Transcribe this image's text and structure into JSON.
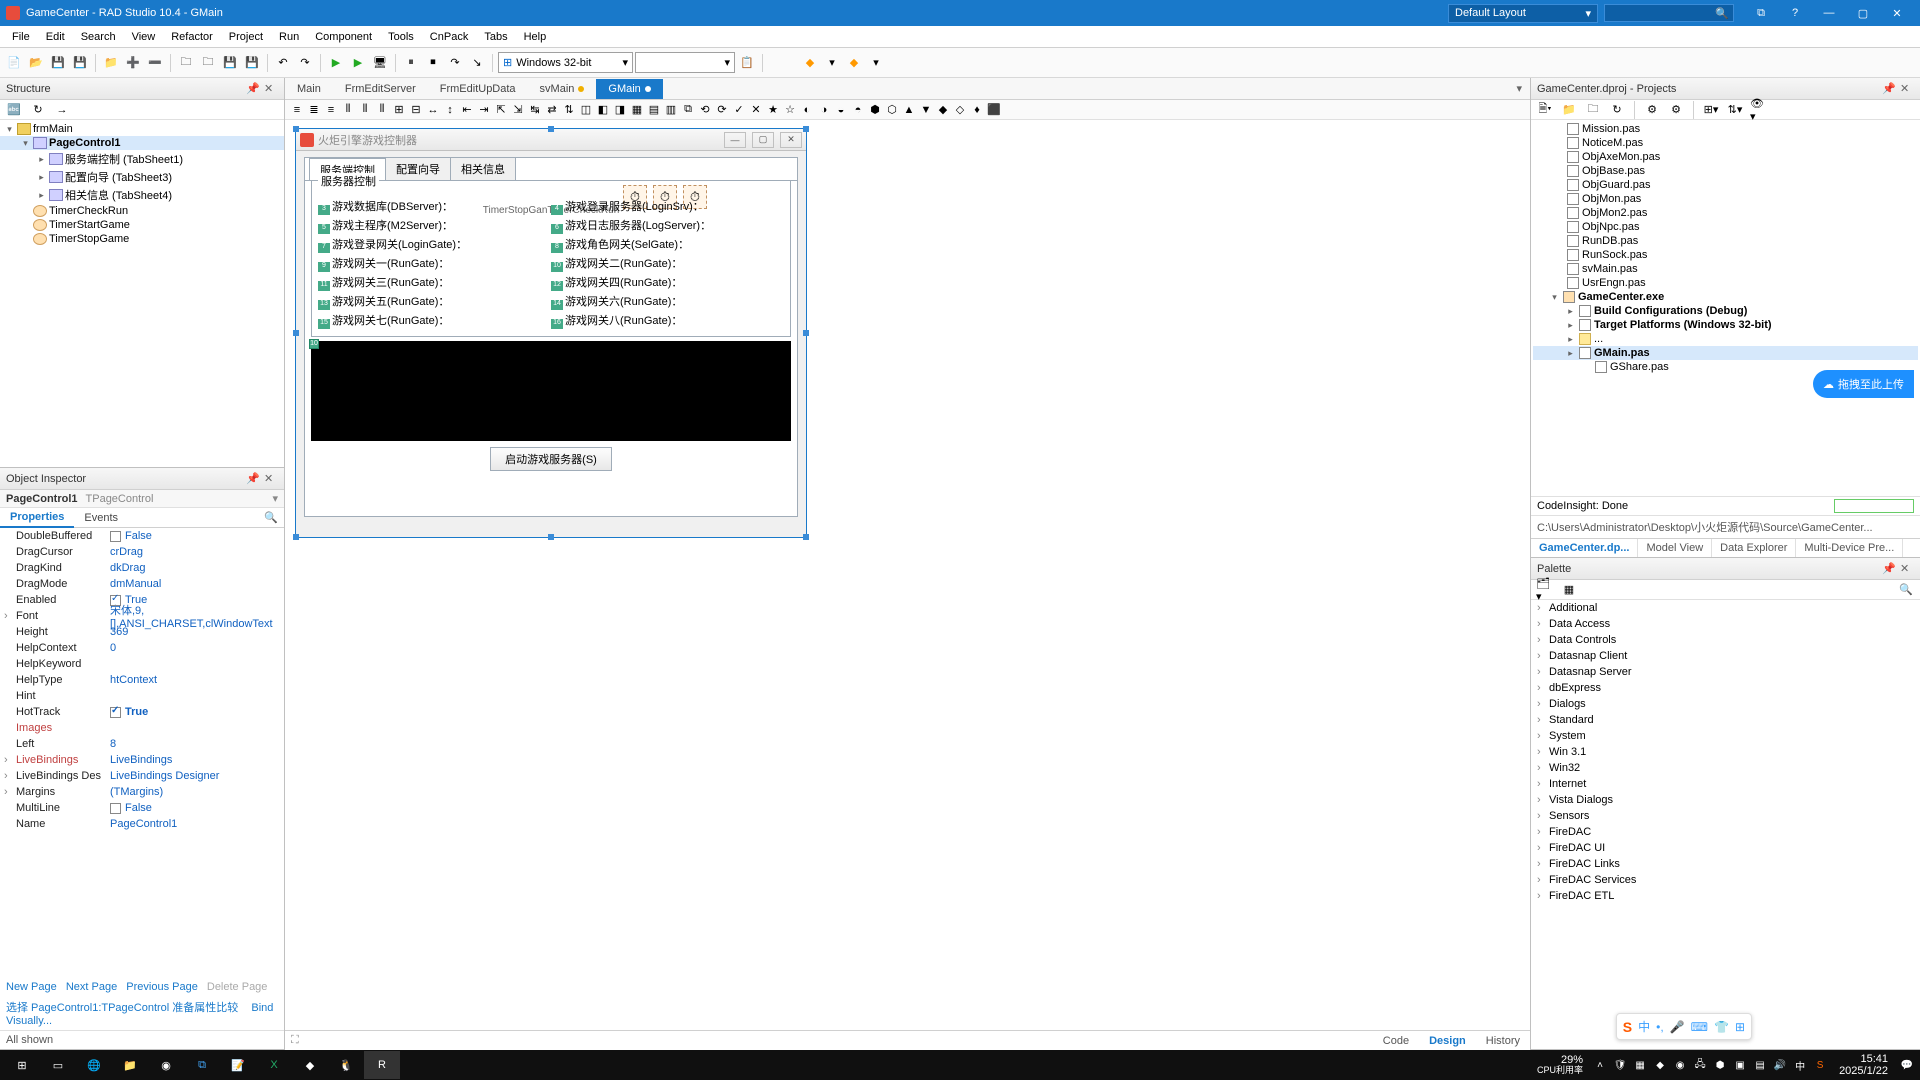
{
  "title": "GameCenter - RAD Studio 10.4 - GMain",
  "layout_selector": "Default Layout",
  "menus": [
    "File",
    "Edit",
    "Search",
    "View",
    "Refactor",
    "Project",
    "Run",
    "Component",
    "Tools",
    "CnPack",
    "Tabs",
    "Help"
  ],
  "platform": "Windows 32-bit",
  "structure": {
    "title": "Structure",
    "root": "frmMain",
    "pagecontrol": "PageControl1",
    "tabs": [
      "服务端控制  (TabSheet1)",
      "配置向导  (TabSheet3)",
      "相关信息  (TabSheet4)"
    ],
    "timers": [
      "TimerCheckRun",
      "TimerStartGame",
      "TimerStopGame"
    ]
  },
  "object_inspector": {
    "title": "Object Inspector",
    "selected": "PageControl1",
    "selected_class": "TPageControl",
    "tabs": [
      "Properties",
      "Events"
    ],
    "rows": [
      {
        "k": "DoubleBuffered",
        "v": "False",
        "chk": false
      },
      {
        "k": "DragCursor",
        "v": "crDrag"
      },
      {
        "k": "DragKind",
        "v": "dkDrag"
      },
      {
        "k": "DragMode",
        "v": "dmManual"
      },
      {
        "k": "Enabled",
        "v": "True",
        "chk": true
      },
      {
        "k": "Font",
        "v": "宋体,9,[],ANSI_CHARSET,clWindowText",
        "sub": true
      },
      {
        "k": "Height",
        "v": "369"
      },
      {
        "k": "HelpContext",
        "v": "0"
      },
      {
        "k": "HelpKeyword",
        "v": ""
      },
      {
        "k": "HelpType",
        "v": "htContext"
      },
      {
        "k": "Hint",
        "v": ""
      },
      {
        "k": "HotTrack",
        "v": "True",
        "chk": true,
        "bold": true
      },
      {
        "k": "Images",
        "v": "",
        "red": true
      },
      {
        "k": "Left",
        "v": "8"
      },
      {
        "k": "LiveBindings",
        "v": "LiveBindings",
        "sub": true,
        "red": true
      },
      {
        "k": "LiveBindings Des",
        "v": "LiveBindings Designer",
        "sub": true
      },
      {
        "k": "Margins",
        "v": "(TMargins)",
        "sub": true
      },
      {
        "k": "MultiLine",
        "v": "False",
        "chk": false
      },
      {
        "k": "Name",
        "v": "PageControl1"
      }
    ],
    "links": {
      "np": "New Page",
      "nxp": "Next Page",
      "pp": "Previous Page",
      "dp": "Delete Page"
    },
    "hint1": "选择 PageControl1:TPageControl 准备属性比较",
    "hint2": "Bind Visually...",
    "shown": "All shown"
  },
  "editor_tabs": [
    {
      "l": "Main"
    },
    {
      "l": "FrmEditServer"
    },
    {
      "l": "FrmEditUpData"
    },
    {
      "l": "svMain",
      "mod": true
    },
    {
      "l": "GMain",
      "mod": true,
      "act": true
    }
  ],
  "design_form": {
    "caption": "火炬引擎游戏控制器",
    "tabs": [
      "服务端控制",
      "配置向导",
      "相关信息"
    ],
    "group": "服务器控制",
    "timerlbl": "TimerStopGanTimerCheckRun",
    "labels": [
      "游戏数据库(DBServer)：",
      "游戏登录服务器(LoginSrv)：",
      "游戏主程序(M2Server)：",
      "游戏日志服务器(LogServer)：",
      "游戏登录网关(LoginGate)：",
      "游戏角色网关(SelGate)：",
      "游戏网关一(RunGate)：",
      "游戏网关二(RunGate)：",
      "游戏网关三(RunGate)：",
      "游戏网关四(RunGate)：",
      "游戏网关五(RunGate)：",
      "游戏网关六(RunGate)：",
      "游戏网关七(RunGate)：",
      "游戏网关八(RunGate)："
    ],
    "button": "启动游戏服务器(S)"
  },
  "view_tabs": [
    "Code",
    "Design",
    "History"
  ],
  "projects": {
    "title": "GameCenter.dproj - Projects",
    "files": [
      "Mission.pas",
      "NoticeM.pas",
      "ObjAxeMon.pas",
      "ObjBase.pas",
      "ObjGuard.pas",
      "ObjMon.pas",
      "ObjMon2.pas",
      "ObjNpc.pas",
      "RunDB.pas",
      "RunSock.pas",
      "svMain.pas",
      "UsrEngn.pas"
    ],
    "exe": "GameCenter.exe",
    "build": "Build Configurations (Debug)",
    "target": "Target Platforms (Windows 32-bit)",
    "dots": "...",
    "gmain": "GMain.pas",
    "gshare": "GShare.pas",
    "codeinsight": "CodeInsight: Done",
    "path": "C:\\Users\\Administrator\\Desktop\\小火炬源代码\\Source\\GameCenter...",
    "lowtabs": [
      "GameCenter.dp...",
      "Model View",
      "Data Explorer",
      "Multi-Device Pre..."
    ]
  },
  "palette": {
    "title": "Palette",
    "cats": [
      "Additional",
      "Data Access",
      "Data Controls",
      "Datasnap Client",
      "Datasnap Server",
      "dbExpress",
      "Dialogs",
      "Standard",
      "System",
      "Win 3.1",
      "Win32",
      "Internet",
      "Vista Dialogs",
      "Sensors",
      "FireDAC",
      "FireDAC UI",
      "FireDAC Links",
      "FireDAC Services",
      "FireDAC ETL"
    ]
  },
  "float_upload": "拖拽至此上传",
  "cpu": {
    "pct": "29%",
    "lbl": "CPU利用率"
  },
  "clock": {
    "t": "15:41",
    "d": "2025/1/22"
  }
}
